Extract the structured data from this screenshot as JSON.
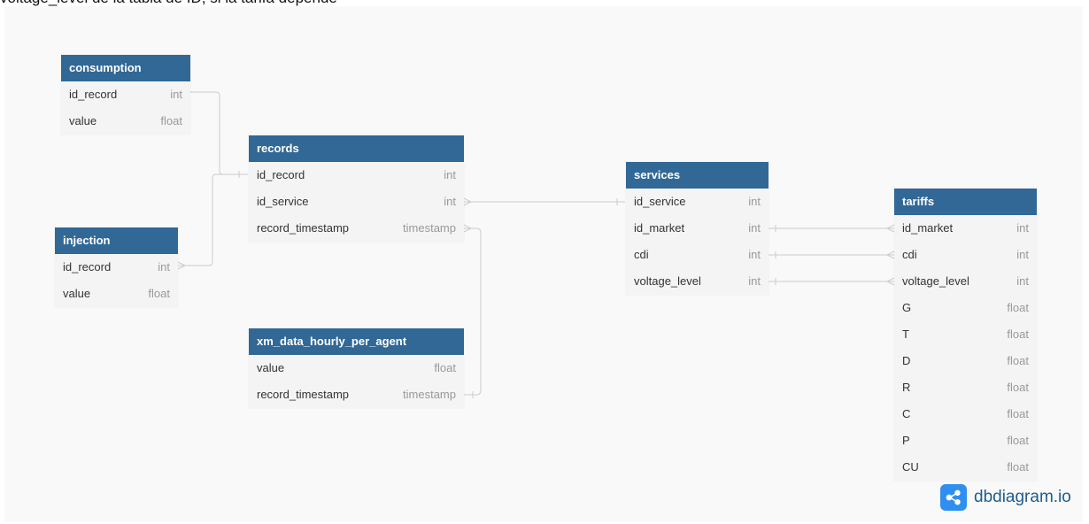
{
  "top_text": "voltage_level de la tabla de ID, si la tarifa depende",
  "brand": "dbdiagram.io",
  "colors": {
    "header": "#316896",
    "canvas": "#f9f9f9",
    "row": "#f4f4f4",
    "line": "#cccccc"
  },
  "tables": {
    "consumption": {
      "name": "consumption",
      "columns": [
        {
          "name": "id_record",
          "type": "int"
        },
        {
          "name": "value",
          "type": "float"
        }
      ]
    },
    "injection": {
      "name": "injection",
      "columns": [
        {
          "name": "id_record",
          "type": "int"
        },
        {
          "name": "value",
          "type": "float"
        }
      ]
    },
    "records": {
      "name": "records",
      "columns": [
        {
          "name": "id_record",
          "type": "int"
        },
        {
          "name": "id_service",
          "type": "int"
        },
        {
          "name": "record_timestamp",
          "type": "timestamp"
        }
      ]
    },
    "xm": {
      "name": "xm_data_hourly_per_agent",
      "columns": [
        {
          "name": "value",
          "type": "float"
        },
        {
          "name": "record_timestamp",
          "type": "timestamp"
        }
      ]
    },
    "services": {
      "name": "services",
      "columns": [
        {
          "name": "id_service",
          "type": "int"
        },
        {
          "name": "id_market",
          "type": "int"
        },
        {
          "name": "cdi",
          "type": "int"
        },
        {
          "name": "voltage_level",
          "type": "int"
        }
      ]
    },
    "tariffs": {
      "name": "tariffs",
      "columns": [
        {
          "name": "id_market",
          "type": "int"
        },
        {
          "name": "cdi",
          "type": "int"
        },
        {
          "name": "voltage_level",
          "type": "int"
        },
        {
          "name": "G",
          "type": "float"
        },
        {
          "name": "T",
          "type": "float"
        },
        {
          "name": "D",
          "type": "float"
        },
        {
          "name": "R",
          "type": "float"
        },
        {
          "name": "C",
          "type": "float"
        },
        {
          "name": "P",
          "type": "float"
        },
        {
          "name": "CU",
          "type": "float"
        }
      ]
    }
  }
}
